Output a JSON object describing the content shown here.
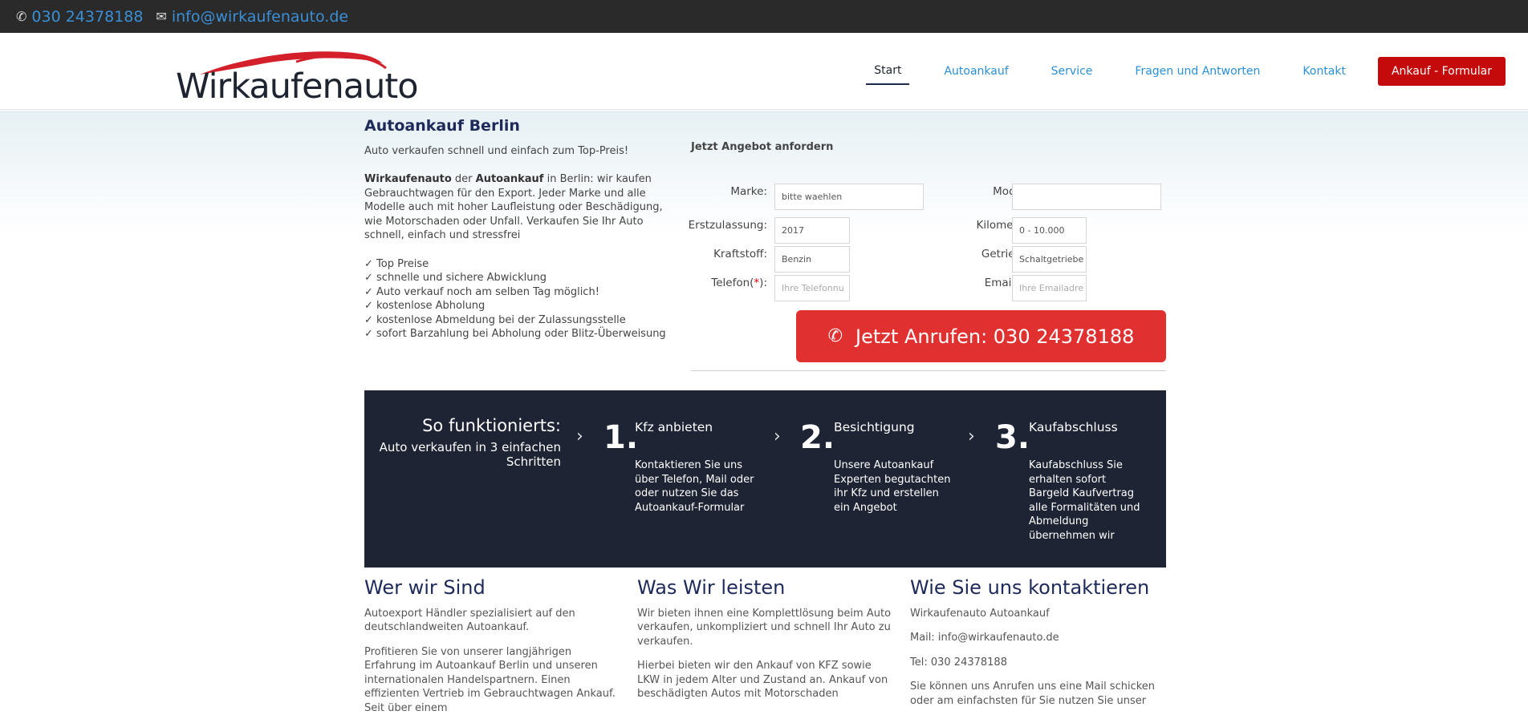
{
  "topbar": {
    "phone": "030 24378188",
    "email": "info@wirkaufenauto.de",
    "phone_icon": "phone-icon",
    "mail_icon": "envelope-icon"
  },
  "logo": {
    "text": "Wirkaufenauto"
  },
  "nav": {
    "items": [
      "Start",
      "Autoankauf",
      "Service",
      "Fragen und Antworten",
      "Kontakt"
    ],
    "cta": "Ankauf - Formular"
  },
  "intro": {
    "title": "Autoankauf Berlin",
    "tagline": "Auto verkaufen schnell und einfach zum Top-Preis!",
    "p_brand": "Wirkaufenauto",
    "p_mid1": " der ",
    "p_bold2": "Autoankauf",
    "p_rest": " in Berlin: wir kaufen Gebrauchtwagen für den Export. Jeder Marke und alle Modelle auch mit hoher Laufleistung oder Beschädigung, wie Motorschaden oder Unfall. Verkaufen Sie Ihr Auto schnell, einfach und stressfrei",
    "checks": [
      "✓ Top Preise",
      "✓ schnelle und sichere Abwicklung",
      "✓ Auto verkauf noch am selben Tag möglich!",
      "✓ kostenlose Abholung",
      "✓ kostenlose Abmeldung bei der Zulassungsstelle",
      "✓ sofort Barzahlung bei Abholung oder Blitz-Überweisung"
    ]
  },
  "form": {
    "title": "Jetzt Angebot anfordern",
    "marke_label": "Marke:",
    "marke_value": "bitte waehlen",
    "modell_label": "Modell:",
    "modell_value": "",
    "erst_label": "Erstzulassung:",
    "erst_value": "2017",
    "km_label": "Kilometer:",
    "km_value": "0 - 10.000",
    "kraft_label": "Kraftstoff:",
    "kraft_value": "Benzin",
    "getriebe_label": "Getriebe:",
    "getriebe_value": "Schaltgetriebe",
    "tel_label": "Telefon(",
    "tel_req": "*",
    "tel_close": "):",
    "tel_placeholder": "Ihre Telefonnu",
    "email_label": "Email(",
    "email_req": "*",
    "email_close": "):",
    "email_placeholder": "Ihre Emailadre"
  },
  "call_button": {
    "label": "Jetzt Anrufen: 030 24378188",
    "icon": "phone-icon"
  },
  "steps": {
    "title": "So funktionierts:",
    "subtitle_1": "Auto verkaufen in 3 einfachen",
    "subtitle_2": "Schritten",
    "items": [
      {
        "num": "1.",
        "title": "Kfz anbieten",
        "text": "Kontaktieren Sie uns über Telefon, Mail oder oder nutzen Sie das Autoankauf-Formular"
      },
      {
        "num": "2.",
        "title": "Besichtigung",
        "text": "Unsere Autoankauf Experten begutachten ihr Kfz und erstellen ein Angebot"
      },
      {
        "num": "3.",
        "title": "Kaufabschluss",
        "text": "Kaufabschluss Sie erhalten sofort Bargeld Kaufvertrag alle Formalitäten und Abmeldung übernehmen wir"
      }
    ]
  },
  "columns": {
    "c1": {
      "title": "Wer wir Sind",
      "p1": "Autoexport Händler spezialisiert auf den deutschlandweiten Autoankauf.",
      "p2": "Profitieren Sie von unserer langjährigen Erfahrung im Autoankauf Berlin und unseren internationalen Handelspartnern. Einen effizienten Vertrieb im Gebrauchtwagen Ankauf. Seit über einem"
    },
    "c2": {
      "title": "Was Wir leisten",
      "p1": "Wir bieten ihnen eine Komplettlösung beim Auto verkaufen, unkompliziert und schnell Ihr Auto zu verkaufen.",
      "p2": "Hierbei bieten wir den Ankauf von KFZ sowie LKW in jedem Alter und Zustand an. Ankauf von beschädigten Autos mit Motorschaden"
    },
    "c3": {
      "title": "Wie Sie uns kontaktieren",
      "p1": "Wirkaufenauto Autoankauf",
      "p2": "Mail: info@wirkaufenauto.de",
      "p3": "Tel: 030 24378188",
      "p4": "Sie können uns Anrufen uns eine Mail schicken oder am einfachsten für Sie nutzen Sie unser"
    }
  },
  "colors": {
    "topbar_bg": "#2a2a2a",
    "link": "#2b8fd6",
    "cta": "#c40a0a",
    "call": "#e03030",
    "steps_bg": "#1e2433",
    "heading": "#1e2a5a"
  }
}
